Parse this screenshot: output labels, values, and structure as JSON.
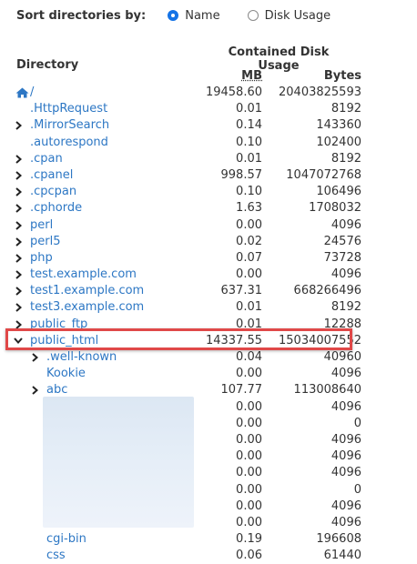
{
  "sort": {
    "label": "Sort directories by:",
    "options": [
      {
        "label": "Name",
        "checked": true
      },
      {
        "label": "Disk Usage",
        "checked": false
      }
    ]
  },
  "table": {
    "dir_header": "Directory",
    "contained_header": "Contained Disk Usage",
    "mb_header": "MB",
    "bytes_header": "Bytes",
    "rows": [
      {
        "name": "/",
        "mb": "19458.60",
        "bytes": "20403825593",
        "level": 0,
        "expander": "none",
        "icon": "home-icon"
      },
      {
        "name": ".HttpRequest",
        "mb": "0.01",
        "bytes": "8192",
        "level": 0,
        "expander": "none"
      },
      {
        "name": ".MirrorSearch",
        "mb": "0.14",
        "bytes": "143360",
        "level": 0,
        "expander": "collapsed"
      },
      {
        "name": ".autorespond",
        "mb": "0.10",
        "bytes": "102400",
        "level": 0,
        "expander": "none"
      },
      {
        "name": ".cpan",
        "mb": "0.01",
        "bytes": "8192",
        "level": 0,
        "expander": "collapsed"
      },
      {
        "name": ".cpanel",
        "mb": "998.57",
        "bytes": "1047072768",
        "level": 0,
        "expander": "collapsed"
      },
      {
        "name": ".cpcpan",
        "mb": "0.10",
        "bytes": "106496",
        "level": 0,
        "expander": "collapsed"
      },
      {
        "name": ".cphorde",
        "mb": "1.63",
        "bytes": "1708032",
        "level": 0,
        "expander": "collapsed"
      },
      {
        "name": "perl",
        "mb": "0.00",
        "bytes": "4096",
        "level": 0,
        "expander": "collapsed"
      },
      {
        "name": "perl5",
        "mb": "0.02",
        "bytes": "24576",
        "level": 0,
        "expander": "collapsed"
      },
      {
        "name": "php",
        "mb": "0.07",
        "bytes": "73728",
        "level": 0,
        "expander": "collapsed"
      },
      {
        "name": "test.example.com",
        "mb": "0.00",
        "bytes": "4096",
        "level": 0,
        "expander": "collapsed"
      },
      {
        "name": "test1.example.com",
        "mb": "637.31",
        "bytes": "668266496",
        "level": 0,
        "expander": "collapsed"
      },
      {
        "name": "test3.example.com",
        "mb": "0.01",
        "bytes": "8192",
        "level": 0,
        "expander": "collapsed"
      },
      {
        "name": "public_ftp",
        "mb": "0.01",
        "bytes": "12288",
        "level": 0,
        "expander": "collapsed"
      },
      {
        "name": "public_html",
        "mb": "14337.55",
        "bytes": "15034007552",
        "level": 0,
        "expander": "expanded",
        "highlighted": true
      },
      {
        "name": ".well-known",
        "mb": "0.04",
        "bytes": "40960",
        "level": 1,
        "expander": "collapsed"
      },
      {
        "name": "Kookie",
        "mb": "0.00",
        "bytes": "4096",
        "level": 1,
        "expander": "none"
      },
      {
        "name": "abc",
        "mb": "107.77",
        "bytes": "113008640",
        "level": 1,
        "expander": "collapsed"
      },
      {
        "name": "",
        "mb": "0.00",
        "bytes": "4096",
        "level": 1,
        "expander": "none",
        "redacted": true
      },
      {
        "name": "",
        "mb": "0.00",
        "bytes": "0",
        "level": 1,
        "expander": "none",
        "redacted": true
      },
      {
        "name": "",
        "mb": "0.00",
        "bytes": "4096",
        "level": 1,
        "expander": "none",
        "redacted": true
      },
      {
        "name": "",
        "mb": "0.00",
        "bytes": "4096",
        "level": 1,
        "expander": "none",
        "redacted": true
      },
      {
        "name": "",
        "mb": "0.00",
        "bytes": "4096",
        "level": 1,
        "expander": "none",
        "redacted": true
      },
      {
        "name": "",
        "mb": "0.00",
        "bytes": "0",
        "level": 1,
        "expander": "none",
        "redacted": true
      },
      {
        "name": "",
        "mb": "0.00",
        "bytes": "4096",
        "level": 1,
        "expander": "none",
        "redacted": true
      },
      {
        "name": "",
        "mb": "0.00",
        "bytes": "4096",
        "level": 1,
        "expander": "none",
        "redacted": true
      },
      {
        "name": "cgi-bin",
        "mb": "0.19",
        "bytes": "196608",
        "level": 1,
        "expander": "none"
      },
      {
        "name": "css",
        "mb": "0.06",
        "bytes": "61440",
        "level": 1,
        "expander": "none"
      }
    ]
  },
  "colors": {
    "link": "#2d77c4",
    "radio_checked": "#1473e6",
    "highlight_border": "#e04848"
  }
}
